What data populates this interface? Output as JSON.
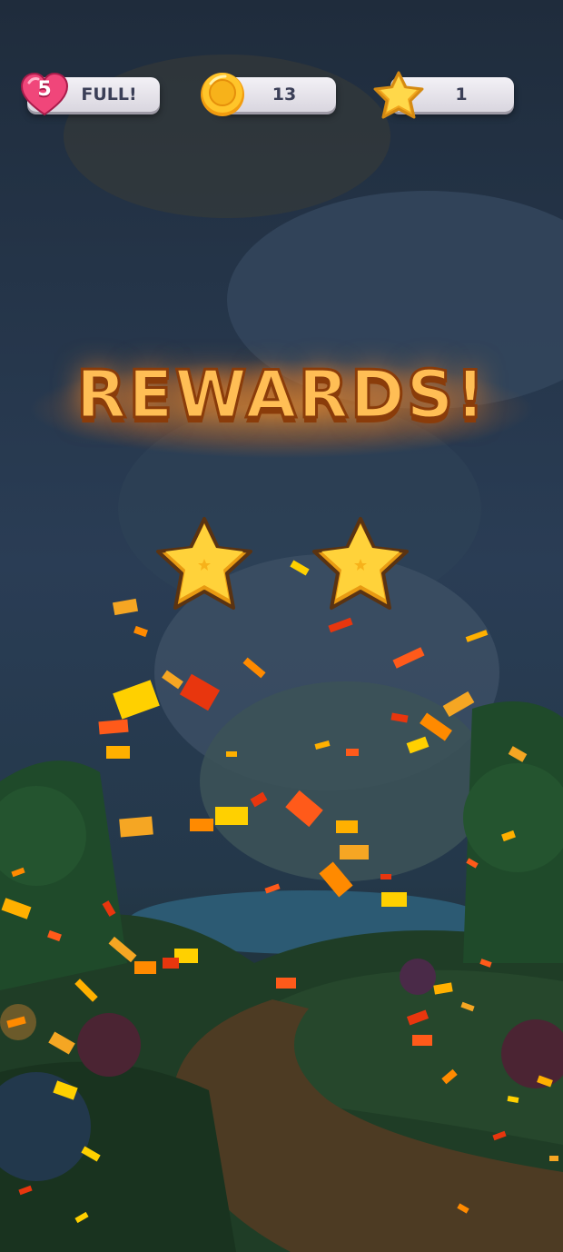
{
  "hud": {
    "lives": {
      "count": "5",
      "status": "FULL!"
    },
    "coins": {
      "value": "13"
    },
    "stars": {
      "value": "1"
    }
  },
  "title": "REWARDS!",
  "rewards": [
    {
      "icon": "star-icon"
    },
    {
      "icon": "star-icon"
    }
  ],
  "colors": {
    "title": "#ffbe55",
    "title_outline": "#8a3c0a",
    "pill": "#e8e6ec",
    "heart": "#f0467a",
    "coin": "#f7b21a",
    "star": "#ffd23a"
  }
}
